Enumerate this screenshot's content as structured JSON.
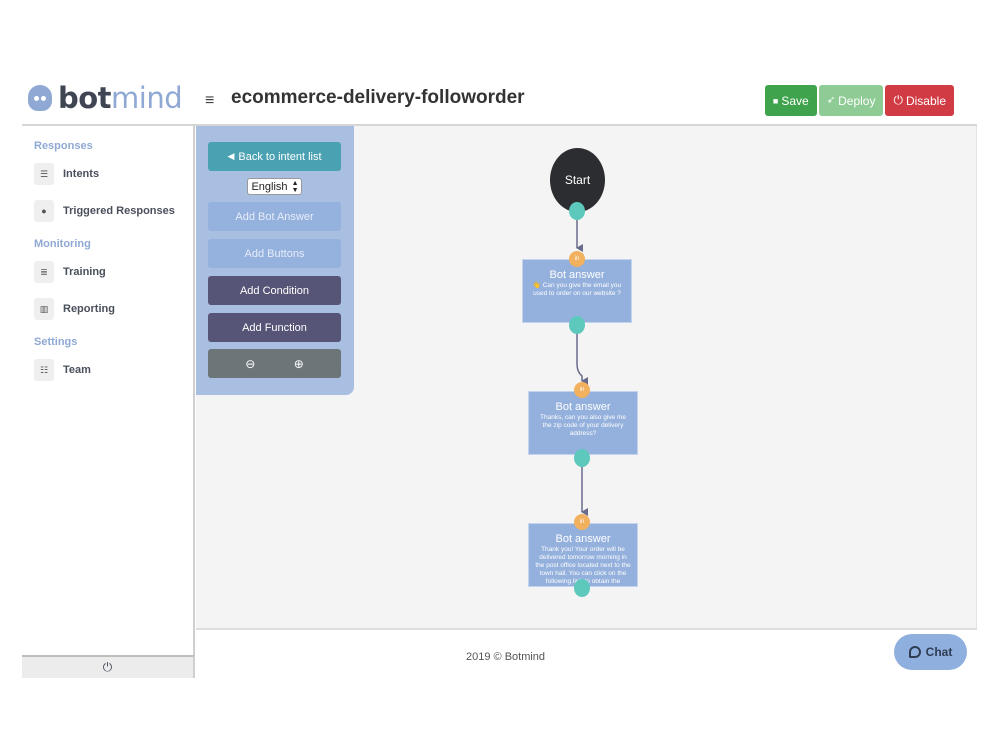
{
  "brand": {
    "part1": "bot",
    "part2": "mind",
    "accent": "#8fa9d4"
  },
  "header": {
    "menu_icon": "≡",
    "title": "ecommerce-delivery-followorder",
    "buttons": {
      "save": {
        "icon": "💾",
        "label": "Save",
        "color": "#3fa34d"
      },
      "deploy": {
        "icon": "🚀",
        "label": "Deploy",
        "color": "#8fcb95"
      },
      "disable": {
        "icon": "⏻",
        "label": "Disable",
        "color": "#d13c44"
      }
    }
  },
  "sidebar": {
    "sections": [
      {
        "title": "Responses",
        "items": [
          {
            "icon": "☰",
            "label": "Intents"
          },
          {
            "icon": "●",
            "label": "Triggered Responses"
          }
        ]
      },
      {
        "title": "Monitoring",
        "items": [
          {
            "icon": "≣",
            "label": "Training"
          },
          {
            "icon": "▥",
            "label": "Reporting"
          }
        ]
      },
      {
        "title": "Settings",
        "items": [
          {
            "icon": "☷",
            "label": "Team"
          }
        ]
      }
    ],
    "footer_icon": "⏻"
  },
  "panel": {
    "back_icon": "◀",
    "back_label": "Back to intent list",
    "language": "English",
    "language_arrows": "▲▼",
    "add_bot_answer": "Add Bot Answer",
    "add_buttons": "Add Buttons",
    "add_condition": "Add Condition",
    "add_function": "Add Function",
    "zoom_out_icon": "⊖",
    "zoom_in_icon": "⊕"
  },
  "flow": {
    "start_label": "Start",
    "in_label": "in",
    "nodes": [
      {
        "title": "Bot answer",
        "message": "👋 Can you give the email you used to order on our website ?"
      },
      {
        "title": "Bot answer",
        "message": "Thanks, can you also give me the zip code of your delivery address?"
      },
      {
        "title": "Bot answer",
        "message": "Thank you! Your order will be delivered tomorrow morning in the post office located next to the town hall. You can click on the following link to obtain the address of this"
      }
    ]
  },
  "footer": {
    "copyright": "2019 © Botmind"
  },
  "chat": {
    "icon": "💬",
    "label": "Chat"
  }
}
